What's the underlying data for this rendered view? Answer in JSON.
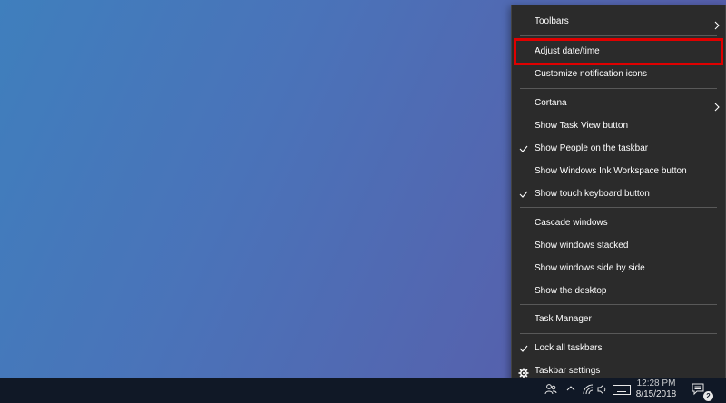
{
  "context_menu": {
    "items": [
      {
        "label": "Toolbars",
        "checked": false,
        "submenu": true
      },
      {
        "label": "Adjust date/time",
        "checked": false,
        "submenu": false,
        "highlighted": true
      },
      {
        "label": "Customize notification icons",
        "checked": false,
        "submenu": false
      },
      {
        "label": "Cortana",
        "checked": false,
        "submenu": true
      },
      {
        "label": "Show Task View button",
        "checked": false,
        "submenu": false
      },
      {
        "label": "Show People on the taskbar",
        "checked": true,
        "submenu": false
      },
      {
        "label": "Show Windows Ink Workspace button",
        "checked": false,
        "submenu": false
      },
      {
        "label": "Show touch keyboard button",
        "checked": true,
        "submenu": false
      },
      {
        "label": "Cascade windows",
        "checked": false,
        "submenu": false
      },
      {
        "label": "Show windows stacked",
        "checked": false,
        "submenu": false
      },
      {
        "label": "Show windows side by side",
        "checked": false,
        "submenu": false
      },
      {
        "label": "Show the desktop",
        "checked": false,
        "submenu": false
      },
      {
        "label": "Task Manager",
        "checked": false,
        "submenu": false
      },
      {
        "label": "Lock all taskbars",
        "checked": true,
        "submenu": false
      },
      {
        "label": "Taskbar settings",
        "checked": false,
        "submenu": false,
        "icon": "gear-icon"
      }
    ],
    "highlight_color": "#e00000"
  },
  "taskbar": {
    "clock_time": "12:28 PM",
    "clock_date": "8/15/2018",
    "notification_count": "2",
    "tray_icons": [
      "people-icon",
      "chevron-up-icon",
      "wifi-icon",
      "volume-icon",
      "keyboard-icon",
      "action-center-icon"
    ]
  },
  "desktop": {
    "gradient_colors": [
      "#3f7fbd",
      "#5a55a6"
    ]
  }
}
